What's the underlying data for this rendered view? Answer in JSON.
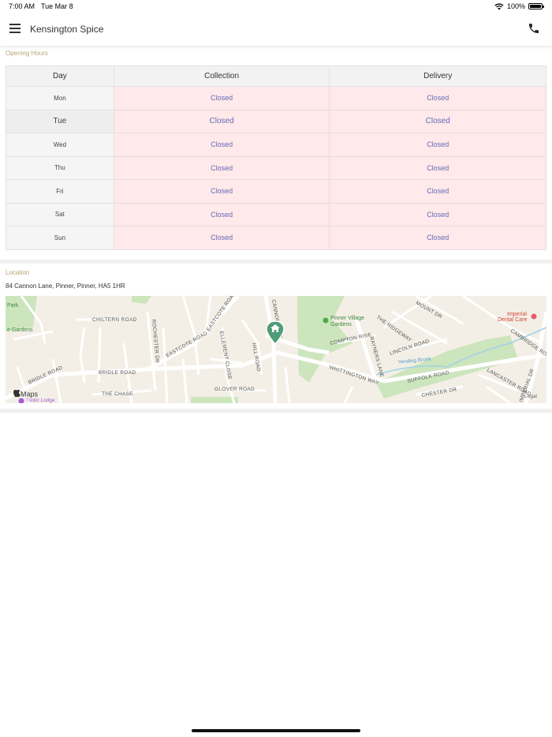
{
  "status_bar": {
    "time": "7:00 AM",
    "date": "Tue Mar 8",
    "battery": "100%"
  },
  "header": {
    "title": "Kensington Spice"
  },
  "opening_hours": {
    "label": "Opening Hours",
    "columns": [
      "Day",
      "Collection",
      "Delivery"
    ],
    "rows": [
      {
        "day": "Mon",
        "collection": "Closed",
        "delivery": "Closed"
      },
      {
        "day": "Tue",
        "collection": "Closed",
        "delivery": "Closed"
      },
      {
        "day": "Wed",
        "collection": "Closed",
        "delivery": "Closed"
      },
      {
        "day": "Thu",
        "collection": "Closed",
        "delivery": "Closed"
      },
      {
        "day": "Fri",
        "collection": "Closed",
        "delivery": "Closed"
      },
      {
        "day": "Sat",
        "collection": "Closed",
        "delivery": "Closed"
      },
      {
        "day": "Sun",
        "collection": "Closed",
        "delivery": "Closed"
      }
    ]
  },
  "location": {
    "label": "Location",
    "address": "84 Cannon Lane, Pinner, Pinner, HA5 1HR"
  },
  "map": {
    "attribution": "Maps",
    "legal": "Legal",
    "labels": {
      "park": "Park",
      "gardens": "e Gardens",
      "pinner_village_gardens_1": "Pinner Village",
      "pinner_village_gardens_2": "Gardens",
      "imperial_1": "Imperial",
      "imperial_2": "Dental Care",
      "tudor_lodge": "Tudor Lodge",
      "vending_brook": "Yending Brook",
      "eastcote_road": "EASTCOTE ROAD",
      "eastcote_road_2": "EASTCOTE ROAD",
      "bridle_road": "BRIDLE ROAD",
      "bridle_road_2": "BRIDLE ROAD",
      "whittington_way": "WHITTINGTON WAY",
      "suffolk_road": "SUFFOLK ROAD",
      "rayners_lane": "RAYNERS LANE",
      "chiltern_road": "CHILTERN ROAD",
      "compton_rise": "COMPTON RISE",
      "lincoln_road": "LINCOLN ROAD",
      "the_ridgeway": "THE RIDGEWAY",
      "cannon_lane": "CANNON LANE",
      "glover_road": "GLOVER ROAD",
      "the_chase": "THE CHASE",
      "chester_dr": "CHESTER DR",
      "hill_road": "HILL ROAD",
      "ellement_close": "ELLEMENT CLOSE",
      "lancaster_road": "LANCASTER ROAD",
      "cambridge_road": "CAMBRIDGE ROAD",
      "imperial_dr": "IMPERIAL DR",
      "mount_dr": "MOUNT DR",
      "rochester_dr": "ROCHESTER DR"
    }
  },
  "colors": {
    "accent_label": "#b8a478",
    "closed_bg": "#ffe9ea",
    "closed_text": "#6469b7",
    "map_pin": "#4e9c78"
  }
}
